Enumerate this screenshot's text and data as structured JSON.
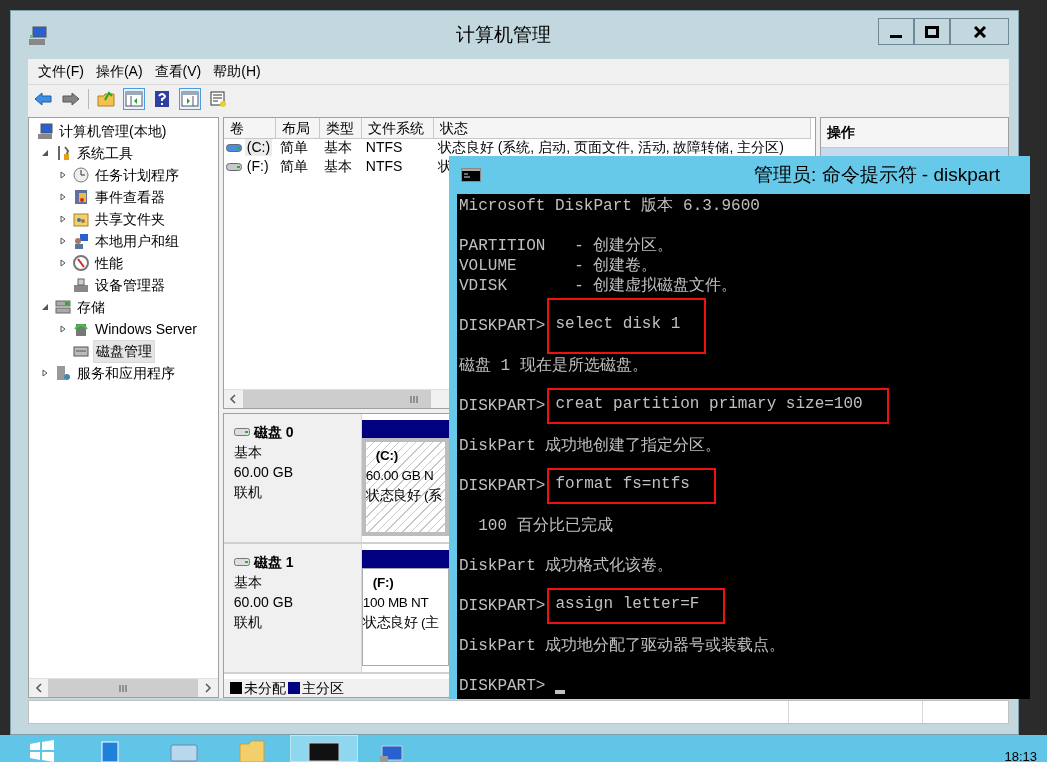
{
  "window": {
    "title": "计算机管理"
  },
  "menu": [
    "文件(F)",
    "操作(A)",
    "查看(V)",
    "帮助(H)"
  ],
  "toolbar": [
    {
      "kind": "back",
      "disabled": false
    },
    {
      "kind": "forward",
      "disabled": true
    },
    {
      "kind": "separator"
    },
    {
      "kind": "up"
    },
    {
      "kind": "tree-pane",
      "on": true
    },
    {
      "kind": "help"
    },
    {
      "kind": "action-pane",
      "on": true
    },
    {
      "kind": "properties"
    }
  ],
  "tree": [
    {
      "label": "计算机管理(本地)",
      "kind": "computer",
      "selected": false,
      "children": [
        {
          "label": "系统工具",
          "kind": "tools",
          "expanded": true,
          "selected": false,
          "children": [
            {
              "label": "任务计划程序",
              "kind": "clock",
              "expanded": false,
              "selected": false
            },
            {
              "label": "事件查看器",
              "kind": "event",
              "expanded": false,
              "selected": false
            },
            {
              "label": "共享文件夹",
              "kind": "share",
              "expanded": false,
              "selected": false
            },
            {
              "label": "本地用户和组",
              "kind": "users",
              "expanded": false,
              "selected": false
            },
            {
              "label": "性能",
              "kind": "perf",
              "expanded": false,
              "selected": false
            },
            {
              "label": "设备管理器",
              "kind": "device",
              "selected": false
            }
          ]
        },
        {
          "label": "存储",
          "kind": "storage",
          "expanded": true,
          "selected": false,
          "children": [
            {
              "label": "Windows Server",
              "kind": "backup",
              "expanded": false,
              "selected": false
            },
            {
              "label": "磁盘管理",
              "kind": "disk",
              "selected": true
            }
          ]
        },
        {
          "label": "服务和应用程序",
          "kind": "services",
          "expanded": false,
          "selected": false
        }
      ]
    }
  ],
  "volumes": {
    "columns": [
      "卷",
      "布局",
      "类型",
      "文件系统",
      "状态"
    ],
    "rows": [
      {
        "kind": "system",
        "selected": true,
        "cells": [
          "(C:)",
          "简单",
          "基本",
          "NTFS",
          "状态良好 (系统, 启动, 页面文件, 活动, 故障转储, 主分区)"
        ]
      },
      {
        "kind": "basic",
        "selected": false,
        "cells": [
          "(F:)",
          "简单",
          "基本",
          "NTFS",
          "状"
        ]
      }
    ]
  },
  "disks": [
    {
      "name": "磁盘 0",
      "type": "基本",
      "size": "60.00 GB",
      "status": "联机",
      "partitions": [
        {
          "label": "(C:)",
          "size": "60.00 GB N",
          "health": "状态良好 (系",
          "selected": true
        }
      ]
    },
    {
      "name": "磁盘 1",
      "type": "基本",
      "size": "60.00 GB",
      "status": "联机",
      "partitions": [
        {
          "label": "(F:)",
          "size": "100 MB NT",
          "health": "状态良好 (主",
          "selected": false
        }
      ]
    }
  ],
  "legend": [
    {
      "label": "未分配",
      "color": "#000000"
    },
    {
      "label": "主分区",
      "color": "#000080"
    }
  ],
  "actions": {
    "title": "操作"
  },
  "cmd": {
    "title": "管理员: 命令提示符 - diskpart",
    "blocks": [
      [
        {
          "kind": "output",
          "text": "Microsoft DiskPart 版本 6.3.9600"
        }
      ],
      [
        {
          "kind": "output",
          "text": "PARTITION   - 创建分区。"
        },
        {
          "kind": "output",
          "text": "VOLUME      - 创建卷。"
        },
        {
          "kind": "output",
          "text": "VDISK       - 创建虚拟磁盘文件。"
        }
      ],
      [
        {
          "kind": "command",
          "prompt": "DISKPART>",
          "text": "select disk 1"
        }
      ],
      [
        {
          "kind": "output",
          "text": "磁盘 1 现在是所选磁盘。"
        }
      ],
      [
        {
          "kind": "command",
          "prompt": "DISKPART>",
          "text": "creat partition primary size=100"
        }
      ],
      [
        {
          "kind": "output",
          "text": "DiskPart 成功地创建了指定分区。"
        }
      ],
      [
        {
          "kind": "command",
          "prompt": "DISKPART>",
          "text": "format fs=ntfs"
        }
      ],
      [
        {
          "kind": "output",
          "text": "  100 百分比已完成"
        }
      ],
      [
        {
          "kind": "output",
          "text": "DiskPart 成功格式化该卷。"
        }
      ],
      [
        {
          "kind": "command",
          "prompt": "DISKPART>",
          "text": "assign letter=F"
        }
      ],
      [
        {
          "kind": "output",
          "text": "DiskPart 成功地分配了驱动器号或装载点。"
        }
      ],
      [
        {
          "kind": "input",
          "prompt": "DISKPART>"
        }
      ]
    ]
  },
  "taskbar": {
    "apps": [
      {
        "kind": "start",
        "selected": false
      },
      {
        "kind": "server-manager",
        "selected": false
      },
      {
        "kind": "powershell",
        "selected": false
      },
      {
        "kind": "explorer",
        "selected": false
      },
      {
        "kind": "cmd",
        "selected": true
      },
      {
        "kind": "computer-management",
        "selected": false
      }
    ],
    "clock": "18:13"
  }
}
